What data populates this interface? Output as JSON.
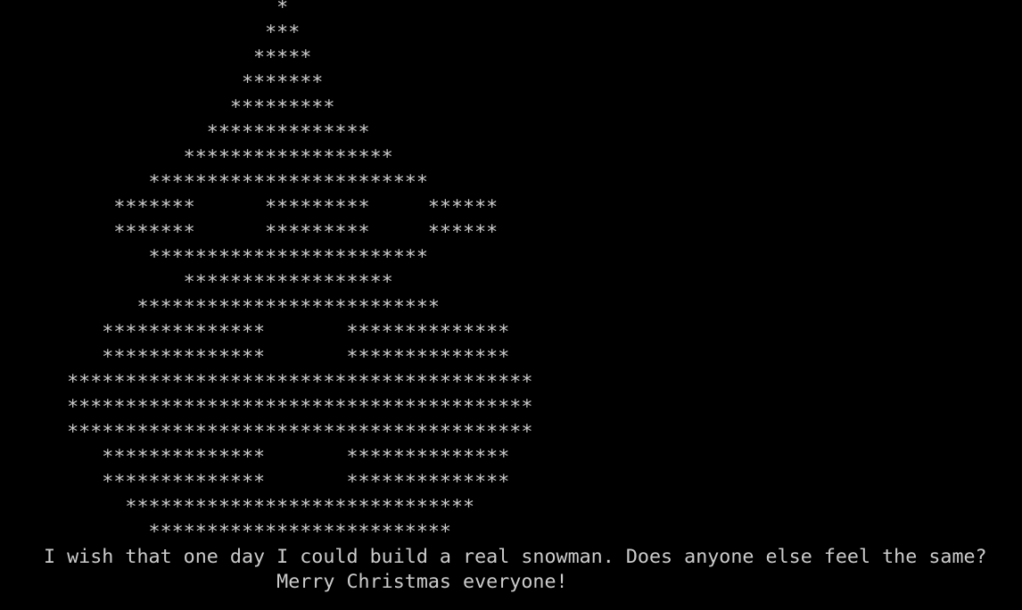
{
  "terminal": {
    "background": "#000000",
    "foreground": "#cccccc",
    "lines": [
      "                    *",
      "                   ***",
      "                  *****",
      "                 *******",
      "                ********* ",
      "              **************",
      "            ******************",
      "         ************************",
      "      *******      *********     ******",
      "      *******      *********     ******",
      "         ************************",
      "            ******************",
      "        **************************",
      "     **************       **************",
      "     **************       **************",
      "  ****************************************",
      "  ****************************************",
      "  ****************************************",
      "     **************       **************",
      "     **************       **************",
      "       ******************************",
      "         **************************",
      "I wish that one day I could build a real snowman. Does anyone else feel the same?",
      "                    Merry Christmas everyone!"
    ]
  }
}
